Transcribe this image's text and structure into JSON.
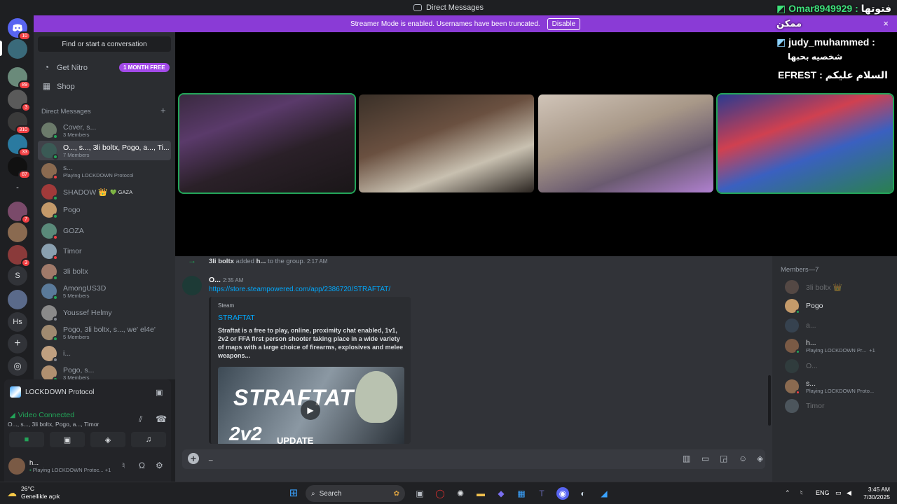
{
  "window": {
    "title": "Direct Messages"
  },
  "streamer_banner": {
    "text": "Streamer Mode is enabled. Usernames have been truncated.",
    "button": "Disable",
    "close": "×"
  },
  "rail": {
    "servers": [
      {
        "label": "",
        "badge": "10"
      },
      {
        "label": "",
        "badge": ""
      },
      {
        "label": "",
        "badge": "89"
      },
      {
        "label": "",
        "badge": "3"
      },
      {
        "label": "",
        "badge": "310"
      },
      {
        "label": "",
        "badge": "33"
      },
      {
        "label": "",
        "badge": "87"
      },
      {
        "label": "-",
        "badge": ""
      },
      {
        "label": "",
        "badge": "7"
      },
      {
        "label": "",
        "badge": ""
      },
      {
        "label": "",
        "badge": "3"
      },
      {
        "label": "S",
        "badge": ""
      },
      {
        "label": "",
        "badge": ""
      },
      {
        "label": "Hs",
        "badge": ""
      }
    ],
    "add_icon": "add-server-icon",
    "discover_icon": "compass-icon"
  },
  "sidebar": {
    "find_placeholder": "Find or start a conversation",
    "nitro_label": "Get Nitro",
    "nitro_badge": "1 MONTH FREE",
    "shop_label": "Shop",
    "dm_header": "Direct Messages",
    "dms": [
      {
        "name": "Cover, s...",
        "sub": "3 Members",
        "color": "#6b7a6a",
        "status": "#23a559",
        "selected": false
      },
      {
        "name": "O..., s..., 3li boltx, Pogo, a..., Ti...",
        "sub": "7 Members",
        "color": "#3a5a55",
        "status": "#23a559",
        "selected": true
      },
      {
        "name": "s...",
        "sub": "Playing LOCKDOWN Protocol",
        "color": "#8a6a50",
        "status": "#f23f43",
        "selected": false
      },
      {
        "name": "SHADOW 👑",
        "sub": "",
        "tag": "💚 GAZA",
        "color": "#a03a3a",
        "status": "#23a559",
        "selected": false
      },
      {
        "name": "Pogo",
        "sub": "",
        "color": "#c49a6a",
        "status": "#23a559",
        "selected": false
      },
      {
        "name": "GOZA",
        "sub": "",
        "color": "#5a8a7a",
        "status": "#f23f43",
        "selected": false
      },
      {
        "name": "Timor",
        "sub": "",
        "color": "#8aa0b0",
        "status": "#f23f43",
        "selected": false
      },
      {
        "name": "3li boltx",
        "sub": "",
        "color": "#a07a6a",
        "status": "#23a559",
        "selected": false
      },
      {
        "name": "AmongUS3D",
        "sub": "5 Members",
        "color": "#5a7a9a",
        "status": "#23a559",
        "selected": false
      },
      {
        "name": "Youssef Helmy",
        "sub": "",
        "color": "#8a8a8a",
        "status": "#80848e",
        "selected": false
      },
      {
        "name": "Pogo, 3li boltx, s..., we' el4e'",
        "sub": "5 Members",
        "color": "#a08a70",
        "status": "#23a559",
        "selected": false
      },
      {
        "name": "i...",
        "sub": "",
        "color": "#c0a080",
        "status": "#80848e",
        "selected": false
      },
      {
        "name": "Pogo, s...",
        "sub": "3 Members",
        "color": "#b09070",
        "status": "#23a559",
        "selected": false
      }
    ]
  },
  "voice": {
    "game": "LOCKDOWN Protocol",
    "status": "Video Connected",
    "members": "O..., s..., 3li boltx, Pogo, a..., Timor",
    "buttons": [
      "camera-icon",
      "screenshare-icon",
      "activity-icon",
      "soundboard-icon"
    ]
  },
  "user": {
    "name": "h...",
    "sub": "Playing LOCKDOWN Protoc...",
    "extra": "+1"
  },
  "overlay": {
    "line1_name": "Omar8949929 :",
    "line1_text": "فتوتها",
    "line2_text": "ممكن",
    "line3_name": "judy_muhammed :",
    "line4_text": "شخصيه بحبها",
    "line5_name": "EFREST :",
    "line5_text": "السلام عليكم"
  },
  "stage": {
    "tiles": [
      {
        "speaking": true,
        "bg": "linear-gradient(160deg,#3a2a40 0%,#5a3a6a 30%,#2a2028 60%,#1a1618 100%)"
      },
      {
        "speaking": false,
        "bg": "linear-gradient(160deg,#3a3028 0%,#6a5040 40%,#c8c0b0 70%,#2a2420 100%)"
      },
      {
        "speaking": false,
        "bg": "linear-gradient(160deg,#d0c4b8 0%,#a89888 40%,#6a5a70 70%,#b080d0 100%)"
      },
      {
        "speaking": true,
        "bg": "linear-gradient(160deg,#2a3a90 0%,#d04050 35%,#3a60c0 60%,#2a8050 100%)"
      }
    ]
  },
  "chat": {
    "system_actor": "3li boltx",
    "system_verb": "added",
    "system_target": "h...",
    "system_rest": "to the group.",
    "system_time": "2:17 AM",
    "author": "O...",
    "time": "2:35 AM",
    "link": "https://store.steampowered.com/app/2386720/STRAFTAT/",
    "embed": {
      "provider": "Steam",
      "title": "STRAFTAT",
      "description": "Straftat is a free to play, online, proximity chat enabled, 1v1, 2v2 or FFA first person shooter taking place in a wide variety of maps with a large choice of firearms, explosives and melee weapons...",
      "image_title": "STRAFTAT",
      "image_mode": "2v2",
      "image_tag": "UPDATE"
    },
    "composer_value": "_"
  },
  "members": {
    "header": "Members—7",
    "list": [
      {
        "name": "3li boltx 👑",
        "sub": "",
        "color": "#a07a6a",
        "status": "",
        "offline": true
      },
      {
        "name": "Pogo",
        "sub": "",
        "color": "#c49a6a",
        "status": "#23a559",
        "offline": false
      },
      {
        "name": "a...",
        "sub": "",
        "color": "#4a6a8a",
        "status": "",
        "offline": true
      },
      {
        "name": "h...",
        "sub": "Playing LOCKDOWN Pr...",
        "extra": "+1",
        "color": "#7a5a45",
        "status": "#23a559",
        "offline": false
      },
      {
        "name": "O...",
        "sub": "",
        "color": "#3a5a55",
        "status": "",
        "offline": true
      },
      {
        "name": "s...",
        "sub": "Playing LOCKDOWN Proto...",
        "color": "#8a6a50",
        "status": "#f23f43",
        "offline": false
      },
      {
        "name": "Timor",
        "sub": "",
        "color": "#8aa0b0",
        "status": "",
        "offline": true
      }
    ]
  },
  "taskbar": {
    "temp": "26°C",
    "weather": "Genellikle açık",
    "search": "Search",
    "lang": "ENG",
    "time": "3:45 AM",
    "date": "7/30/2025"
  }
}
